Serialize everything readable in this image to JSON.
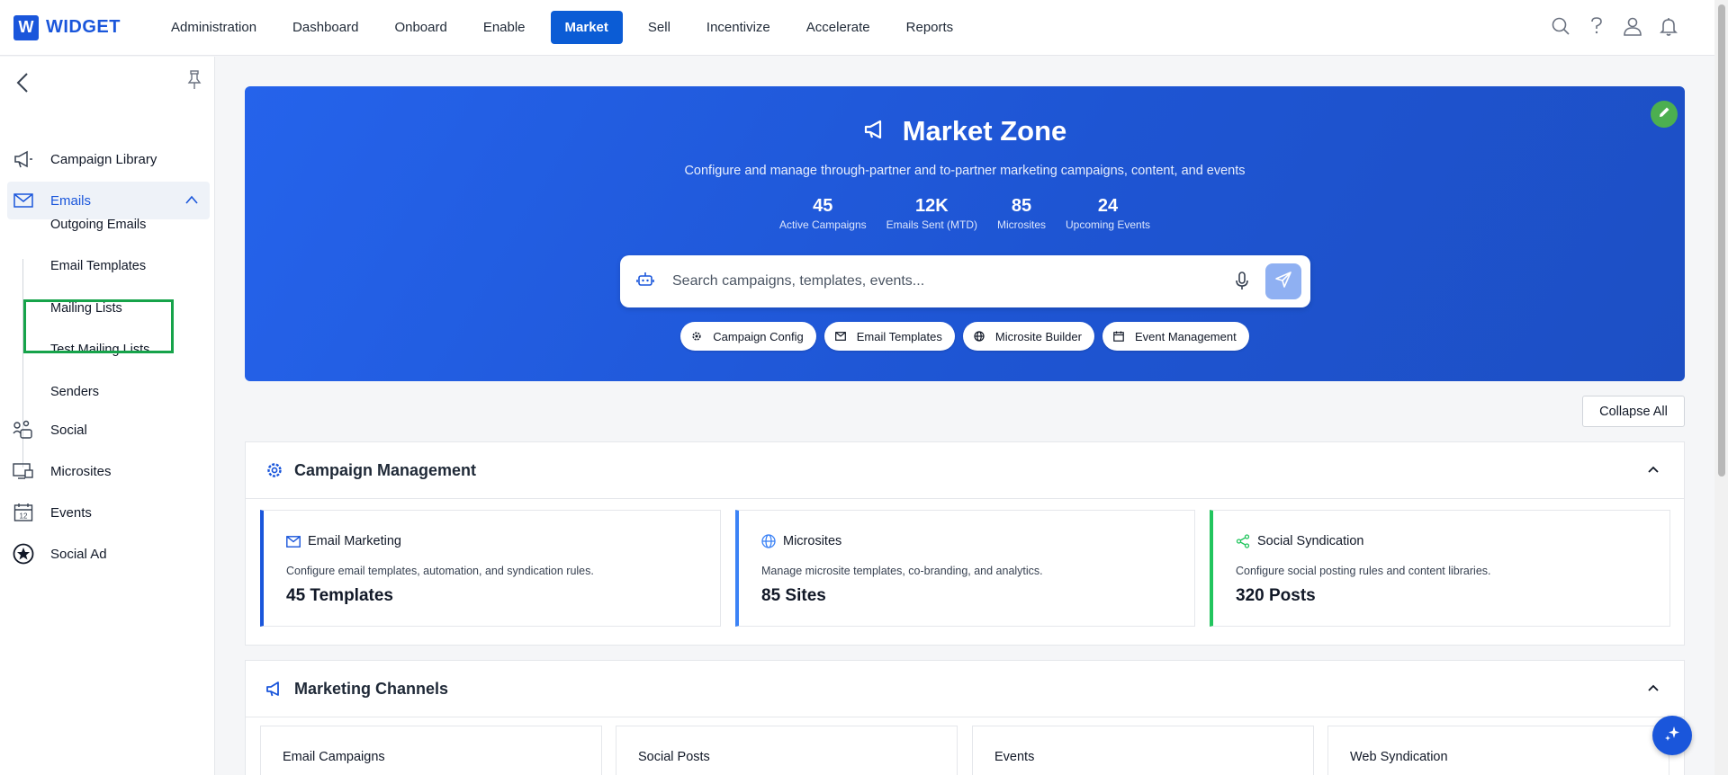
{
  "app": {
    "logo_letter": "W",
    "logo_text": "WIDGET"
  },
  "nav": {
    "items": [
      {
        "label": "Administration"
      },
      {
        "label": "Dashboard"
      },
      {
        "label": "Onboard"
      },
      {
        "label": "Enable"
      },
      {
        "label": "Market",
        "active": true
      },
      {
        "label": "Sell"
      },
      {
        "label": "Incentivize"
      },
      {
        "label": "Accelerate"
      },
      {
        "label": "Reports"
      }
    ],
    "icons": [
      "search-icon",
      "help-icon",
      "user-icon",
      "bell-icon"
    ]
  },
  "sidebar": {
    "items": [
      {
        "label": "Campaign Library",
        "icon": "megaphone-icon"
      },
      {
        "label": "Emails",
        "icon": "envelope-icon",
        "expanded": true
      },
      {
        "label": "Social",
        "icon": "social-icon"
      },
      {
        "label": "Microsites",
        "icon": "microsite-icon"
      },
      {
        "label": "Events",
        "icon": "calendar-icon"
      },
      {
        "label": "Social Ad",
        "icon": "star-badge-icon"
      }
    ],
    "email_subitems": [
      {
        "label": "Outgoing Emails"
      },
      {
        "label": "Email Templates",
        "highlighted": true
      },
      {
        "label": "Mailing Lists"
      },
      {
        "label": "Test Mailing Lists"
      },
      {
        "label": "Senders"
      }
    ]
  },
  "hero": {
    "title": "Market Zone",
    "subtitle": "Configure and manage through-partner and to-partner marketing campaigns, content, and events",
    "stats": [
      {
        "value": "45",
        "label": "Active Campaigns"
      },
      {
        "value": "12K",
        "label": "Emails Sent (MTD)"
      },
      {
        "value": "85",
        "label": "Microsites"
      },
      {
        "value": "24",
        "label": "Upcoming Events"
      }
    ],
    "search_placeholder": "Search campaigns, templates, events...",
    "chips": [
      {
        "label": "Campaign Config",
        "icon": "gear-icon"
      },
      {
        "label": "Email Templates",
        "icon": "envelope-icon"
      },
      {
        "label": "Microsite Builder",
        "icon": "globe-icon"
      },
      {
        "label": "Event Management",
        "icon": "calendar-icon"
      }
    ]
  },
  "collapse_all_label": "Collapse All",
  "campaign_management": {
    "title": "Campaign Management",
    "cards": [
      {
        "title": "Email Marketing",
        "desc": "Configure email templates, automation, and syndication rules.",
        "value": "45 Templates",
        "accent": "#1a56db"
      },
      {
        "title": "Microsites",
        "desc": "Manage microsite templates, co-branding, and analytics.",
        "value": "85 Sites",
        "accent": "#3b82f6"
      },
      {
        "title": "Social Syndication",
        "desc": "Configure social posting rules and content libraries.",
        "value": "320 Posts",
        "accent": "#22c55e"
      }
    ]
  },
  "marketing_channels": {
    "title": "Marketing Channels",
    "cards": [
      {
        "title": "Email Campaigns"
      },
      {
        "title": "Social Posts"
      },
      {
        "title": "Events"
      },
      {
        "title": "Web Syndication"
      }
    ]
  },
  "colors": {
    "brand": "#1a56db",
    "highlight_box": "#16a34a",
    "edit_button": "#4caf50"
  }
}
